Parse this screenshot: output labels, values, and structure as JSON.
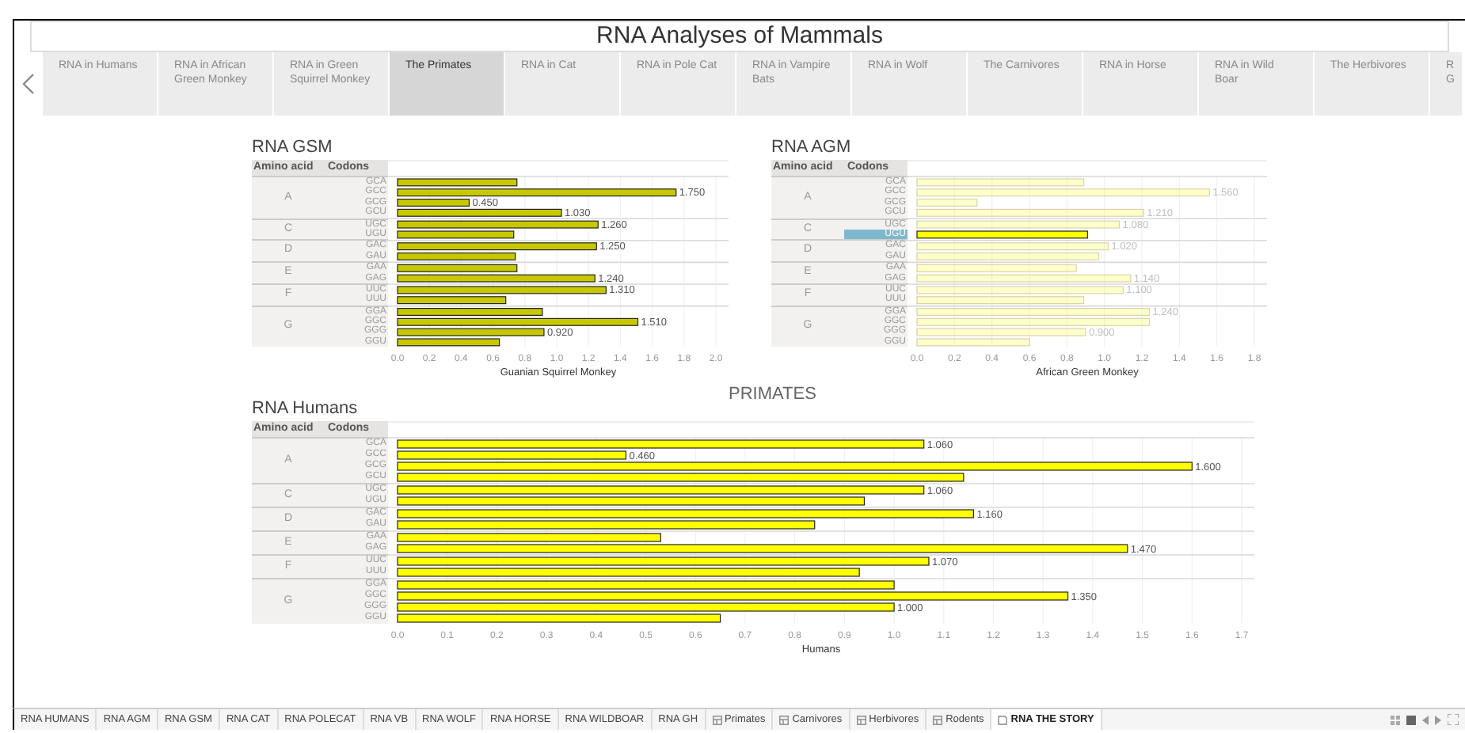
{
  "title": "RNA Analyses of Mammals",
  "nav_tabs": [
    {
      "label": "RNA in Humans",
      "selected": false
    },
    {
      "label": "RNA in African Green Monkey",
      "selected": false
    },
    {
      "label": "RNA in Green Squirrel Monkey",
      "selected": false
    },
    {
      "label": "The Primates",
      "selected": true
    },
    {
      "label": "RNA in Cat",
      "selected": false
    },
    {
      "label": "RNA in Pole Cat",
      "selected": false
    },
    {
      "label": "RNA in Vampire Bats",
      "selected": false
    },
    {
      "label": "RNA in Wolf",
      "selected": false
    },
    {
      "label": "The Carnivores",
      "selected": false
    },
    {
      "label": "RNA in Horse",
      "selected": false
    },
    {
      "label": "RNA in Wild Boar",
      "selected": false
    },
    {
      "label": "The Herbivores",
      "selected": false
    },
    {
      "label": "R G",
      "selected": false
    }
  ],
  "panels": [
    {
      "title": "RNA GSM",
      "header": [
        "Amino acid",
        "Codons"
      ],
      "groups": [
        {
          "amino_acid": "A",
          "codons": [
            {
              "label": "GCA",
              "selected": false
            },
            {
              "label": "GCC",
              "selected": false
            },
            {
              "label": "GCG",
              "selected": false
            },
            {
              "label": "GCU",
              "selected": false
            }
          ]
        },
        {
          "amino_acid": "C",
          "codons": [
            {
              "label": "UGC",
              "selected": false
            },
            {
              "label": "UGU",
              "selected": false
            }
          ]
        },
        {
          "amino_acid": "D",
          "codons": [
            {
              "label": "GAC",
              "selected": false
            },
            {
              "label": "GAU",
              "selected": false
            }
          ]
        },
        {
          "amino_acid": "E",
          "codons": [
            {
              "label": "GAA",
              "selected": false
            },
            {
              "label": "GAG",
              "selected": false
            }
          ]
        },
        {
          "amino_acid": "F",
          "codons": [
            {
              "label": "UUC",
              "selected": false
            },
            {
              "label": "UUU",
              "selected": false
            }
          ]
        },
        {
          "amino_acid": "G",
          "codons": [
            {
              "label": "GGA",
              "selected": false
            },
            {
              "label": "GGC",
              "selected": false
            },
            {
              "label": "GGG",
              "selected": false
            },
            {
              "label": "GGU",
              "selected": false
            }
          ]
        }
      ],
      "chart_data": {
        "type": "bar",
        "orientation": "horizontal",
        "grid": true,
        "xlim": [
          0,
          2
        ],
        "xticks": [
          {
            "value": 0,
            "label": "0.0"
          },
          {
            "value": 0.2,
            "label": "0.2"
          },
          {
            "value": 0.4,
            "label": "0.4"
          },
          {
            "value": 0.6,
            "label": "0.6"
          },
          {
            "value": 0.8,
            "label": "0.8"
          },
          {
            "value": 1,
            "label": "1.0"
          },
          {
            "value": 1.2,
            "label": "1.2"
          },
          {
            "value": 1.4,
            "label": "1.4"
          },
          {
            "value": 1.6,
            "label": "1.6"
          },
          {
            "value": 1.8,
            "label": "1.8"
          },
          {
            "value": 2,
            "label": "2.0"
          }
        ],
        "series": [
          {
            "name": "Guanian Squirrel Monkey",
            "color": "#c8c800",
            "values": [
              0.75,
              1.75,
              0.45,
              1.03,
              1.26,
              0.73,
              1.25,
              0.74,
              0.75,
              1.24,
              1.31,
              0.68,
              0.91,
              1.51,
              0.92,
              0.64
            ]
          }
        ],
        "value_labels": [
          null,
          "1.750",
          "0.450",
          "1.030",
          "1.260",
          null,
          "1.250",
          null,
          null,
          "1.240",
          "1.310",
          null,
          null,
          "1.510",
          "0.920",
          null
        ]
      }
    },
    {
      "title": "RNA AGM",
      "header": [
        "Amino acid",
        "Codons"
      ],
      "groups": [
        {
          "amino_acid": "A",
          "codons": [
            {
              "label": "GCA",
              "selected": false
            },
            {
              "label": "GCC",
              "selected": false
            },
            {
              "label": "GCG",
              "selected": false
            },
            {
              "label": "GCU",
              "selected": false
            }
          ]
        },
        {
          "amino_acid": "C",
          "codons": [
            {
              "label": "UGC",
              "selected": false
            },
            {
              "label": "UGU",
              "selected": true
            }
          ]
        },
        {
          "amino_acid": "D",
          "codons": [
            {
              "label": "GAC",
              "selected": false
            },
            {
              "label": "GAU",
              "selected": false
            }
          ]
        },
        {
          "amino_acid": "E",
          "codons": [
            {
              "label": "GAA",
              "selected": false
            },
            {
              "label": "GAG",
              "selected": false
            }
          ]
        },
        {
          "amino_acid": "F",
          "codons": [
            {
              "label": "UUC",
              "selected": false
            },
            {
              "label": "UUU",
              "selected": false
            }
          ]
        },
        {
          "amino_acid": "G",
          "codons": [
            {
              "label": "GGA",
              "selected": false
            },
            {
              "label": "GGC",
              "selected": false
            },
            {
              "label": "GGG",
              "selected": false
            },
            {
              "label": "GGU",
              "selected": false
            }
          ]
        }
      ],
      "chart_data": {
        "type": "bar",
        "orientation": "horizontal",
        "grid": true,
        "xlim": [
          0,
          1.8
        ],
        "xticks": [
          {
            "value": 0,
            "label": "0.0"
          },
          {
            "value": 0.2,
            "label": "0.2"
          },
          {
            "value": 0.4,
            "label": "0.4"
          },
          {
            "value": 0.6,
            "label": "0.6"
          },
          {
            "value": 0.8,
            "label": "0.8"
          },
          {
            "value": 1,
            "label": "1.0"
          },
          {
            "value": 1.2,
            "label": "1.2"
          },
          {
            "value": 1.4,
            "label": "1.4"
          },
          {
            "value": 1.6,
            "label": "1.6"
          },
          {
            "value": 1.8,
            "label": "1.8"
          }
        ],
        "series": [
          {
            "name": "African Green Monkey",
            "color": "#ffff00",
            "values": [
              0.89,
              1.56,
              0.32,
              1.21,
              1.08,
              0.91,
              1.02,
              0.97,
              0.85,
              1.14,
              1.1,
              0.89,
              1.24,
              1.24,
              0.9,
              0.6
            ]
          }
        ],
        "value_labels": [
          null,
          "1.560",
          null,
          "1.210",
          "1.080",
          null,
          "1.020",
          null,
          null,
          "1.140",
          "1.100",
          null,
          "1.240",
          null,
          "0.900",
          null
        ]
      }
    }
  ],
  "primates_heading": "PRIMATES",
  "humans_panel": {
    "title": "RNA Humans",
    "header": [
      "Amino acid",
      "Codons"
    ],
    "groups": [
      {
        "amino_acid": "A",
        "codons": [
          {
            "label": "GCA",
            "selected": false
          },
          {
            "label": "GCC",
            "selected": false
          },
          {
            "label": "GCG",
            "selected": false
          },
          {
            "label": "GCU",
            "selected": false
          }
        ]
      },
      {
        "amino_acid": "C",
        "codons": [
          {
            "label": "UGC",
            "selected": false
          },
          {
            "label": "UGU",
            "selected": false
          }
        ]
      },
      {
        "amino_acid": "D",
        "codons": [
          {
            "label": "GAC",
            "selected": false
          },
          {
            "label": "GAU",
            "selected": false
          }
        ]
      },
      {
        "amino_acid": "E",
        "codons": [
          {
            "label": "GAA",
            "selected": false
          },
          {
            "label": "GAG",
            "selected": false
          }
        ]
      },
      {
        "amino_acid": "F",
        "codons": [
          {
            "label": "UUC",
            "selected": false
          },
          {
            "label": "UUU",
            "selected": false
          }
        ]
      },
      {
        "amino_acid": "G",
        "codons": [
          {
            "label": "GGA",
            "selected": false
          },
          {
            "label": "GGC",
            "selected": false
          },
          {
            "label": "GGG",
            "selected": false
          },
          {
            "label": "GGU",
            "selected": false
          }
        ]
      }
    ],
    "chart_data": {
      "type": "bar",
      "orientation": "horizontal",
      "grid": true,
      "xlim": [
        0,
        1.7
      ],
      "xticks": [
        {
          "value": 0,
          "label": "0.0"
        },
        {
          "value": 0.1,
          "label": "0.1"
        },
        {
          "value": 0.2,
          "label": "0.2"
        },
        {
          "value": 0.3,
          "label": "0.3"
        },
        {
          "value": 0.4,
          "label": "0.4"
        },
        {
          "value": 0.5,
          "label": "0.5"
        },
        {
          "value": 0.6,
          "label": "0.6"
        },
        {
          "value": 0.7,
          "label": "0.7"
        },
        {
          "value": 0.8,
          "label": "0.8"
        },
        {
          "value": 0.9,
          "label": "0.9"
        },
        {
          "value": 1,
          "label": "1.0"
        },
        {
          "value": 1.1,
          "label": "1.1"
        },
        {
          "value": 1.2,
          "label": "1.2"
        },
        {
          "value": 1.3,
          "label": "1.3"
        },
        {
          "value": 1.4,
          "label": "1.4"
        },
        {
          "value": 1.5,
          "label": "1.5"
        },
        {
          "value": 1.6,
          "label": "1.6"
        },
        {
          "value": 1.7,
          "label": "1.7"
        }
      ],
      "series": [
        {
          "name": "Humans",
          "color": "#ffff00",
          "values": [
            1.06,
            0.46,
            1.6,
            1.14,
            1.06,
            0.94,
            1.16,
            0.84,
            0.53,
            1.47,
            1.07,
            0.93,
            1.0,
            1.35,
            1.0,
            0.65
          ]
        }
      ],
      "value_labels": [
        "1.060",
        "0.460",
        "1.600",
        null,
        "1.060",
        null,
        "1.160",
        null,
        null,
        "1.470",
        "1.070",
        null,
        null,
        "1.350",
        "1.000",
        null
      ]
    }
  },
  "sheet_tabs": [
    {
      "label": "RNA HUMANS",
      "kind": "sheet",
      "selected": false
    },
    {
      "label": "RNA AGM",
      "kind": "sheet",
      "selected": false
    },
    {
      "label": "RNA GSM",
      "kind": "sheet",
      "selected": false
    },
    {
      "label": "RNA CAT",
      "kind": "sheet",
      "selected": false
    },
    {
      "label": "RNA POLECAT",
      "kind": "sheet",
      "selected": false
    },
    {
      "label": "RNA VB",
      "kind": "sheet",
      "selected": false
    },
    {
      "label": "RNA WOLF",
      "kind": "sheet",
      "selected": false
    },
    {
      "label": "RNA HORSE",
      "kind": "sheet",
      "selected": false
    },
    {
      "label": "RNA WILDBOAR",
      "kind": "sheet",
      "selected": false
    },
    {
      "label": "RNA GH",
      "kind": "sheet",
      "selected": false
    },
    {
      "label": "Primates",
      "kind": "dashboard",
      "selected": false
    },
    {
      "label": "Carnivores",
      "kind": "dashboard",
      "selected": false
    },
    {
      "label": "Herbivores",
      "kind": "dashboard",
      "selected": false
    },
    {
      "label": "Rodents",
      "kind": "dashboard",
      "selected": false
    },
    {
      "label": "RNA THE STORY",
      "kind": "story",
      "selected": true
    }
  ]
}
